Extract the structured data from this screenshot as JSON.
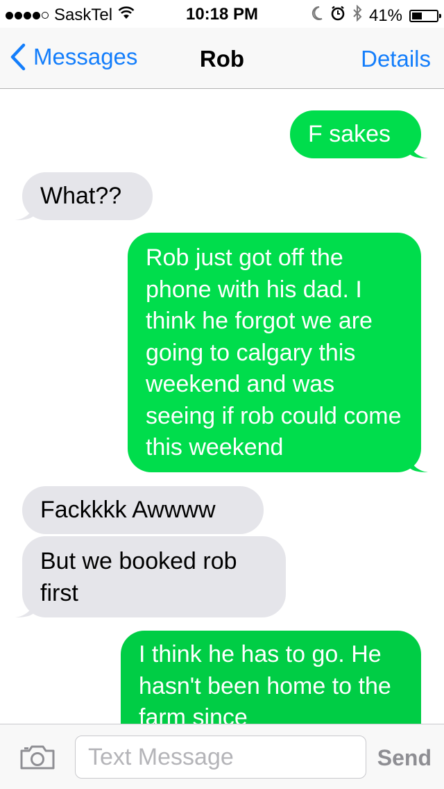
{
  "status_bar": {
    "carrier": "SaskTel",
    "time": "10:18 PM",
    "battery": "41%",
    "battery_level": 0.41,
    "signal_bars": 4,
    "signal_max": 5
  },
  "nav": {
    "back_label": "Messages",
    "title": "Rob",
    "details_label": "Details"
  },
  "messages": [
    {
      "direction": "outgoing",
      "text": "F sakes"
    },
    {
      "direction": "incoming",
      "text": "What??"
    },
    {
      "direction": "outgoing",
      "text": "Rob just got off the phone with his dad. I think he forgot we are going to calgary this weekend and was seeing if rob could come this weekend"
    },
    {
      "direction": "incoming",
      "text": "Fackkkk Awwww"
    },
    {
      "direction": "incoming",
      "text": "But we booked rob first"
    },
    {
      "direction": "outgoing",
      "text": "I think he has to go. He hasn't been home to the farm since"
    }
  ],
  "input": {
    "placeholder": "Text Message",
    "value": "",
    "send_label": "Send"
  },
  "colors": {
    "accent": "#147efb",
    "outgoing_bubble": "#00dd4c",
    "incoming_bubble": "#e5e5ea"
  },
  "icons": [
    "wifi-icon",
    "moon-icon",
    "alarm-icon",
    "bluetooth-icon",
    "battery-icon",
    "back-chevron-icon",
    "camera-icon"
  ]
}
